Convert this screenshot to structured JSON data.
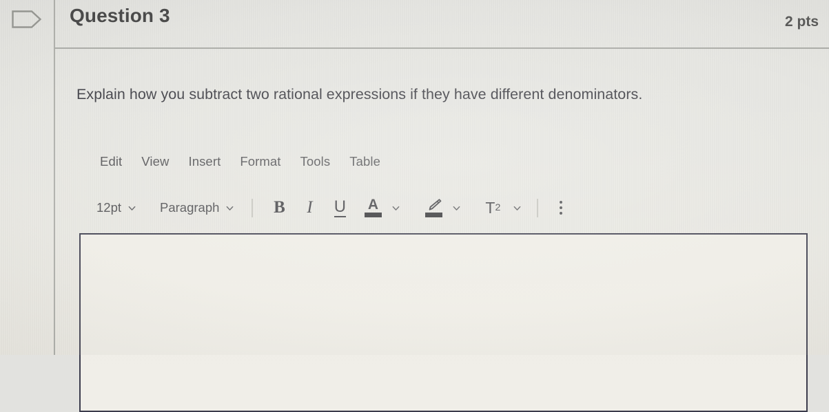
{
  "header": {
    "flag_icon": "question-flag-icon",
    "title": "Question 3",
    "points": "2 pts"
  },
  "question": {
    "prompt": "Explain how you subtract two rational expressions if they have different denominators."
  },
  "editor": {
    "menubar": [
      {
        "label": "Edit"
      },
      {
        "label": "View"
      },
      {
        "label": "Insert"
      },
      {
        "label": "Format"
      },
      {
        "label": "Tools"
      },
      {
        "label": "Table"
      }
    ],
    "toolbar": {
      "font_size": "12pt",
      "block_format": "Paragraph",
      "bold_label": "B",
      "italic_label": "I",
      "underline_label": "U",
      "text_color_label": "A",
      "highlight_icon": "highlighter-pen-icon",
      "superscript_label": "T",
      "superscript_exponent": "2",
      "more_icon": "kebab-more-icon",
      "caret_icon": "chevron-down-icon"
    },
    "content": "",
    "placeholder": ""
  },
  "colors": {
    "page_background": "#e5e5e1",
    "divider": "#a6a7a3",
    "title_text": "#39393a",
    "body_text": "#32323a",
    "toolbar_text": "#4a4a4e",
    "editor_border": "#3b3b4c",
    "editor_background": "#efede7",
    "swatch_text_color": "#2f2f33",
    "swatch_highlight_color": "#2f2f33"
  }
}
